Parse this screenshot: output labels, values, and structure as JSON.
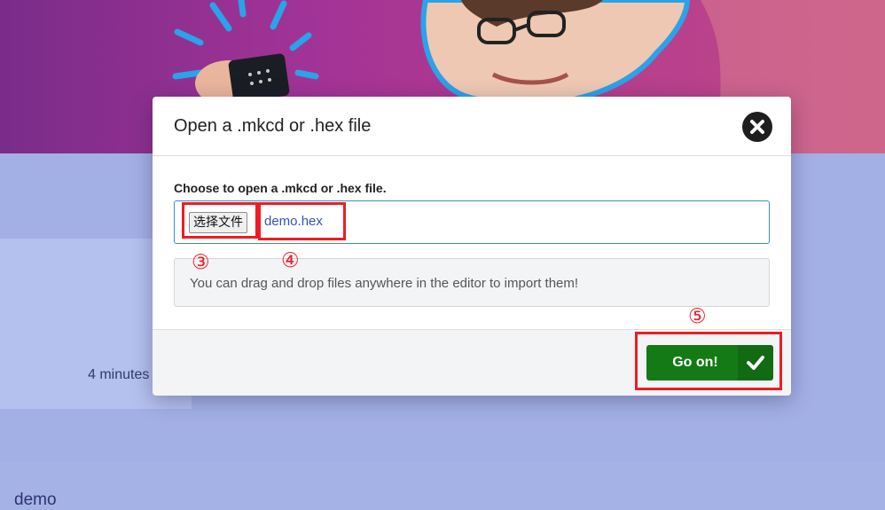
{
  "background": {
    "project_card": {
      "title": "demo",
      "modified": "4 minutes"
    }
  },
  "dialog": {
    "title": "Open a .mkcd or .hex file",
    "close_icon": "close-circle-icon",
    "file_prompt": "Choose to open a .mkcd or .hex file.",
    "choose_file_label": "选择文件",
    "selected_file": "demo.hex",
    "drag_hint": "You can drag and drop files anywhere in the editor to import them!",
    "confirm_label": "Go on!",
    "confirm_icon": "checkmark-icon"
  },
  "annotations": {
    "choose_file_marker": "③",
    "file_name_marker": "④",
    "confirm_marker": "⑤",
    "color": "#ee1c24"
  },
  "colors": {
    "hero_start": "#7a2c8a",
    "hero_end": "#c24a86",
    "backdrop": "#a3b0e6",
    "field_border": "#3a8fbd",
    "file_name_text": "#3453b8",
    "confirm_green": "#137a16"
  }
}
